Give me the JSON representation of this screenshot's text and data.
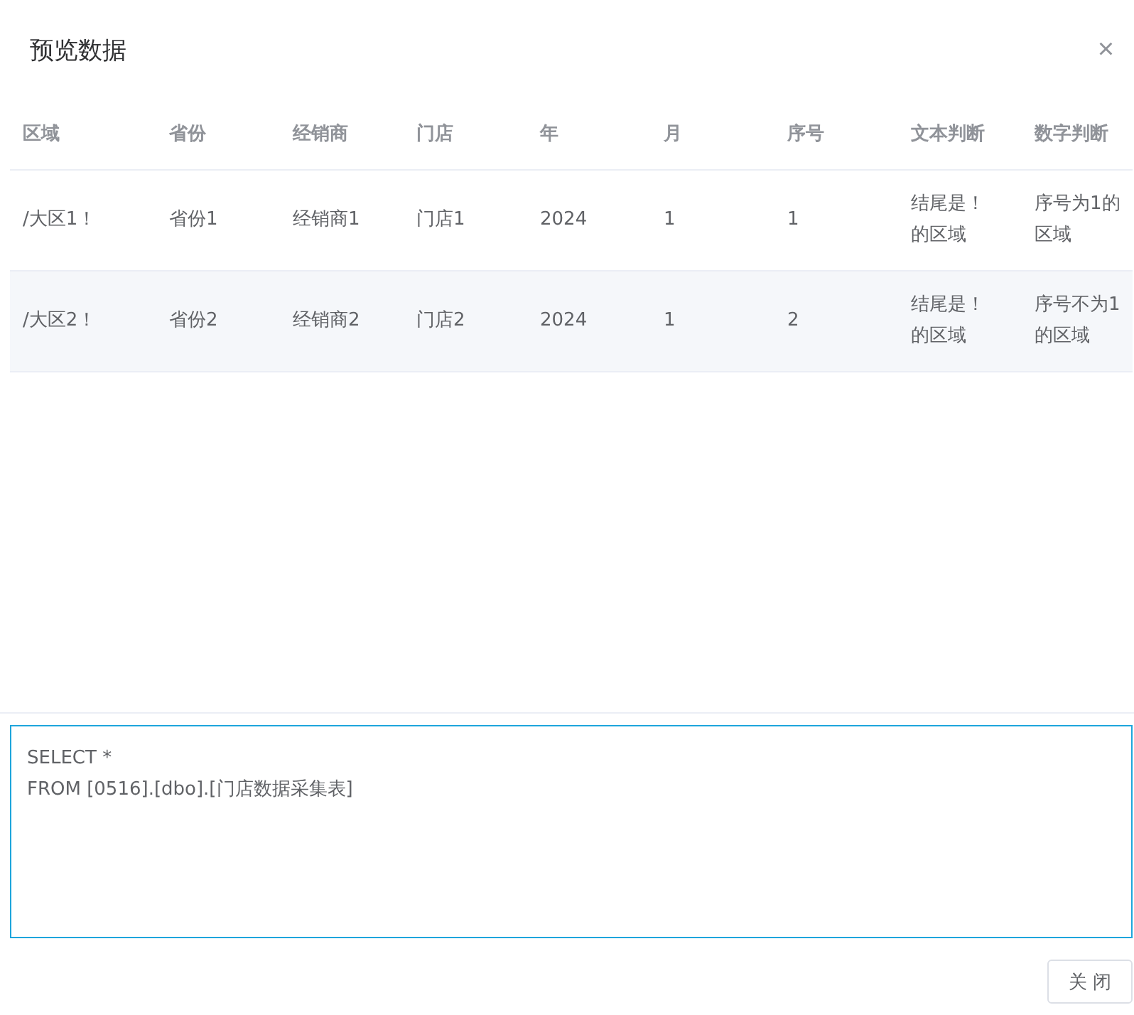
{
  "dialog": {
    "title": "预览数据",
    "close_icon": "×"
  },
  "table": {
    "columns": [
      "区域",
      "省份",
      "经销商",
      "门店",
      "年",
      "月",
      "序号",
      "文本判断",
      "数字判断"
    ],
    "rows": [
      {
        "color": "#ffffff",
        "cells": [
          "/大区1！",
          "省份1",
          "经销商1",
          "门店1",
          "2024",
          "1",
          "1",
          "结尾是！的区域",
          "序号为1的区域"
        ]
      },
      {
        "color": "#f5f7fa",
        "cells": [
          "/大区2！",
          "省份2",
          "经销商2",
          "门店2",
          "2024",
          "1",
          "2",
          "结尾是！的区域",
          "序号不为1的区域"
        ]
      }
    ]
  },
  "sql_editor": {
    "value": "SELECT *\nFROM [0516].[dbo].[门店数据采集表]",
    "focused": true
  },
  "buttons": [
    "关 闭"
  ]
}
